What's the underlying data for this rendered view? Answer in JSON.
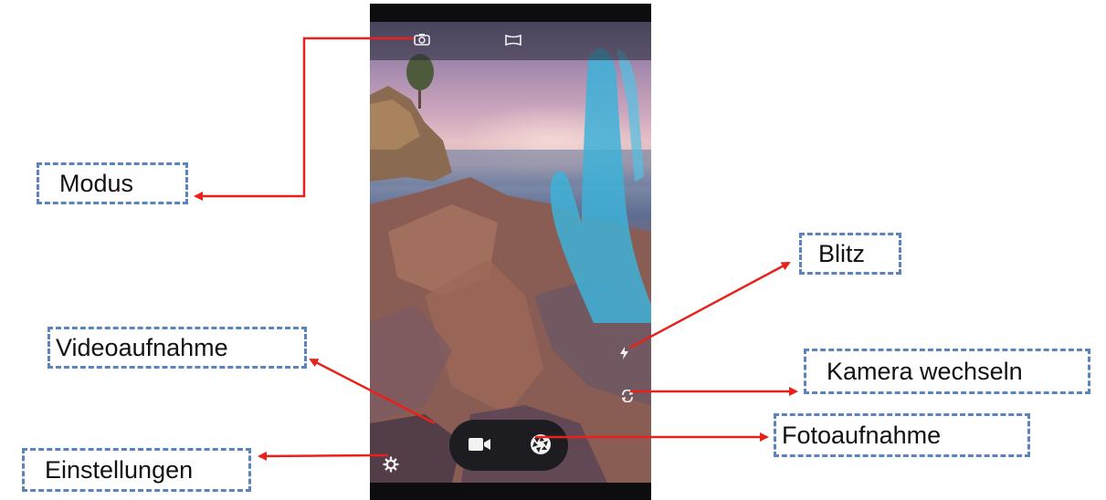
{
  "annotations": {
    "modus": "Modus",
    "blitz": "Blitz",
    "videoaufnahme": "Videoaufnahme",
    "kamera_wechseln": "Kamera wechseln",
    "fotoaufnahme": "Fotoaufnahme",
    "einstellungen": "Einstellungen"
  },
  "camera_ui": {
    "top_bar_icons": [
      "mode-icon",
      "panorama-icon"
    ],
    "side_icons": [
      "flash-icon",
      "switch-camera-icon"
    ],
    "bottom_left_icon": "settings-icon",
    "capture_buttons": [
      "video-record-icon",
      "shutter-icon"
    ]
  },
  "colors": {
    "annotation_arrow": "#e8211b",
    "callout_border": "#5b83be",
    "phone_frame": "#0d0d0f"
  }
}
